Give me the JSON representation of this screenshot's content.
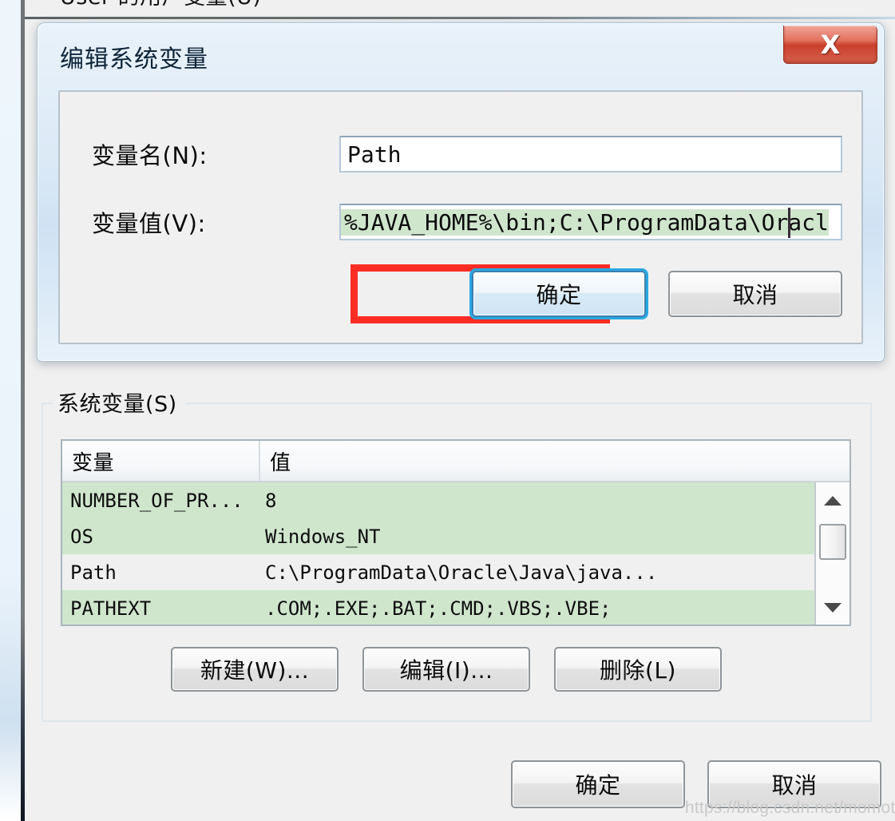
{
  "background_dialog": {
    "clipped_top_label": "User 的用户变量(U)",
    "system_vars_group": {
      "title": "系统变量(S)",
      "columns": [
        "变量",
        "值"
      ],
      "rows": [
        {
          "variable": "NUMBER_OF_PR...",
          "value": "8"
        },
        {
          "variable": "OS",
          "value": "Windows_NT"
        },
        {
          "variable": "Path",
          "value": "C:\\ProgramData\\Oracle\\Java\\java..."
        },
        {
          "variable": "PATHEXT",
          "value": ".COM;.EXE;.BAT;.CMD;.VBS;.VBE;"
        }
      ],
      "buttons": {
        "new": "新建(W)...",
        "edit": "编辑(I)...",
        "delete": "删除(L)"
      },
      "scrollbar": {
        "up_arrow": "scroll-up-icon",
        "down_arrow": "scroll-down-icon"
      }
    },
    "footer_buttons": {
      "ok": "确定",
      "cancel": "取消"
    }
  },
  "edit_dialog": {
    "title": "编辑系统变量",
    "close_button": "X",
    "fields": [
      {
        "label": "变量名(N):",
        "value": "Path"
      },
      {
        "label": "变量值(V):",
        "value": "%JAVA_HOME%\\bin;C:\\ProgramData\\Oracl"
      }
    ],
    "buttons": {
      "ok": "确定",
      "cancel": "取消"
    },
    "annotation": {
      "shape": "rectangle",
      "color": "#fc2d25"
    }
  },
  "watermark": "https://blog.csdn.net/momotougua",
  "colors": {
    "selection_green": "#cfe6cd",
    "annotation_red": "#fc2d25",
    "close_red": "#c9402c",
    "focus_blue": "#29a8e0",
    "dialog_blue": "#cfe2f3"
  }
}
